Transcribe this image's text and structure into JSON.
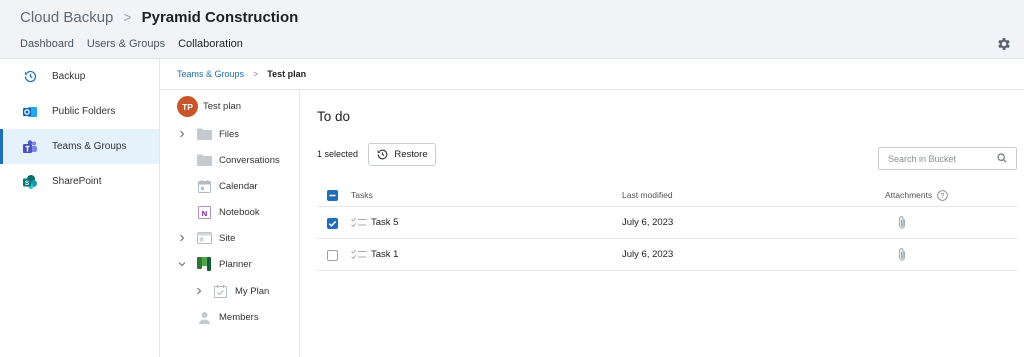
{
  "header": {
    "app_name": "Cloud Backup",
    "separator": ">",
    "org_name": "Pyramid Construction"
  },
  "topnav": {
    "items": [
      {
        "label": "Dashboard"
      },
      {
        "label": "Users & Groups"
      },
      {
        "label": "Collaboration"
      }
    ],
    "active_index": 2
  },
  "sidebar": {
    "items": [
      {
        "label": "Backup",
        "icon": "history-icon"
      },
      {
        "label": "Public Folders",
        "icon": "outlook-icon"
      },
      {
        "label": "Teams & Groups",
        "icon": "teams-icon"
      },
      {
        "label": "SharePoint",
        "icon": "sharepoint-icon"
      }
    ],
    "active_index": 2
  },
  "breadcrumb": {
    "link": "Teams & Groups",
    "separator": ">",
    "current": "Test plan"
  },
  "tree": {
    "root": {
      "initials": "TP",
      "label": "Test plan",
      "avatar_color": "#c8562a"
    },
    "items": [
      {
        "label": "Files",
        "icon": "folder-icon",
        "expander": "collapsed"
      },
      {
        "label": "Conversations",
        "icon": "folder-icon",
        "expander": "none"
      },
      {
        "label": "Calendar",
        "icon": "calendar-icon",
        "expander": "none"
      },
      {
        "label": "Notebook",
        "icon": "onenote-icon",
        "expander": "none"
      },
      {
        "label": "Site",
        "icon": "site-icon",
        "expander": "collapsed"
      },
      {
        "label": "Planner",
        "icon": "planner-icon",
        "expander": "expanded"
      },
      {
        "label": "My Plan",
        "icon": "plan-icon",
        "expander": "collapsed"
      },
      {
        "label": "Members",
        "icon": "person-icon",
        "expander": "none"
      }
    ]
  },
  "main": {
    "title": "To do",
    "selected_text": "1 selected",
    "restore_label": "Restore",
    "search_placeholder": "Search in Bucket",
    "columns": {
      "tasks": "Tasks",
      "last_modified": "Last modified",
      "attachments": "Attachments"
    },
    "rows": [
      {
        "name": "Task 5",
        "modified": "July 6, 2023",
        "checked": true
      },
      {
        "name": "Task 1",
        "modified": "July 6, 2023",
        "checked": false
      }
    ]
  },
  "colors": {
    "accent": "#1e6fb8",
    "header_bg": "#f1f3f6",
    "active_bg": "#e5f1fb",
    "avatar": "#c8562a"
  }
}
